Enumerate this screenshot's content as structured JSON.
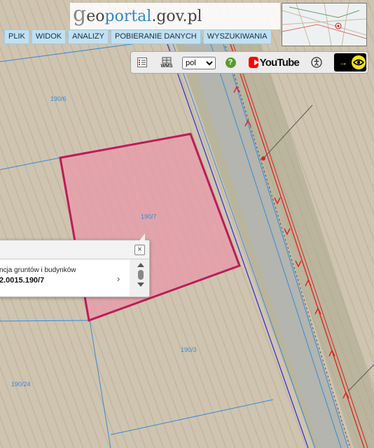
{
  "header": {
    "logo_g": "g",
    "logo_eo": "eo",
    "logo_portal": "portal",
    "logo_domain": ".gov.pl",
    "menu": [
      "PLIK",
      "WIDOK",
      "ANALIZY",
      "POBIERANIE DANYCH",
      "WYSZUKIWANIA"
    ]
  },
  "toolbar": {
    "lang_selected": "pol",
    "lang_options": [
      "pol"
    ],
    "help_label": "?",
    "wms_label": "WMS",
    "youtube_label": "YouTube",
    "accessibility_arrow": "→"
  },
  "map": {
    "parcel_labels": [
      "190/6",
      "190/7",
      "190/3",
      "190/24"
    ],
    "colors": {
      "selected_fill": "#e89aa8",
      "selected_stroke": "#c01a5a",
      "parcel_lines": "#3a8ad8",
      "boundary_line": "#2a2ad8",
      "red_line": "#e02020",
      "field_bg": "#cfc4b0",
      "road": "#b3b5ae"
    }
  },
  "popup": {
    "line1": "ncja gruntów i budynków",
    "line2": "2.0015.190/7",
    "close_label": "×",
    "next_label": "›"
  }
}
